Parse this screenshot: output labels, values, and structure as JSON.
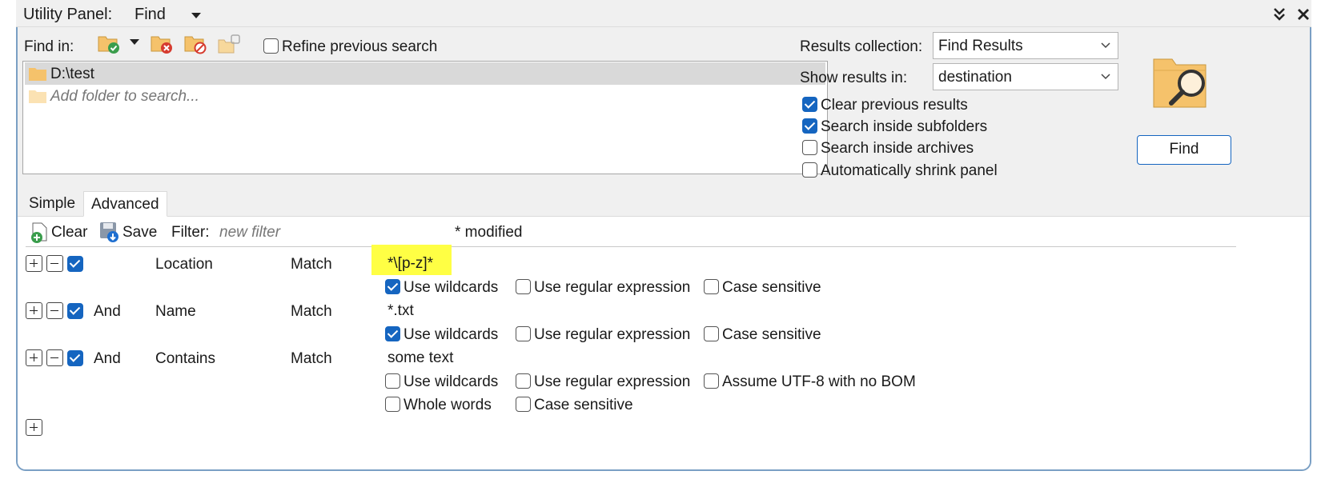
{
  "titlebar": {
    "label": "Utility Panel:",
    "value": "Find",
    "dropdown_icon": "caret-down-icon",
    "collapse_icon": "double-chevron-down-icon",
    "close_icon": "close-icon"
  },
  "findin": {
    "label": "Find in:",
    "refine_label": "Refine previous search",
    "refine_checked": false
  },
  "folders": {
    "items": [
      "D:\\test"
    ],
    "placeholder": "Add folder to search..."
  },
  "options": {
    "results_collection_label": "Results collection:",
    "results_collection_value": "Find Results",
    "show_results_label": "Show results in:",
    "show_results_value": "destination",
    "clear_previous": {
      "label": "Clear previous results",
      "checked": true
    },
    "search_subfolders": {
      "label": "Search inside subfolders",
      "checked": true
    },
    "search_archives": {
      "label": "Search inside archives",
      "checked": false
    },
    "auto_shrink": {
      "label": "Automatically shrink panel",
      "checked": false
    }
  },
  "find_button": "Find",
  "tabs": [
    "Simple",
    "Advanced"
  ],
  "toolbar": {
    "clear": "Clear",
    "save": "Save",
    "filter_label": "Filter:",
    "filter_placeholder": "new filter",
    "status": "* modified"
  },
  "rules": [
    {
      "enabled": true,
      "op": "",
      "field": "Location",
      "match": "Match",
      "value": "*\\[p-z]*",
      "highlighted": true,
      "opts": [
        {
          "label": "Use wildcards",
          "checked": true
        },
        {
          "label": "Use regular expression",
          "checked": false
        },
        {
          "label": "Case sensitive",
          "checked": false
        }
      ]
    },
    {
      "enabled": true,
      "op": "And",
      "field": "Name",
      "match": "Match",
      "value": "*.txt",
      "highlighted": false,
      "opts": [
        {
          "label": "Use wildcards",
          "checked": true
        },
        {
          "label": "Use regular expression",
          "checked": false
        },
        {
          "label": "Case sensitive",
          "checked": false
        }
      ]
    },
    {
      "enabled": true,
      "op": "And",
      "field": "Contains",
      "match": "Match",
      "value": "some text",
      "highlighted": false,
      "opts": [
        {
          "label": "Use wildcards",
          "checked": false
        },
        {
          "label": "Use regular expression",
          "checked": false
        },
        {
          "label": "Assume UTF-8 with no BOM",
          "checked": false
        },
        {
          "label": "Whole words",
          "checked": false
        },
        {
          "label": "Case sensitive",
          "checked": false
        }
      ]
    }
  ],
  "colors": {
    "accent": "#1565c0",
    "highlight": "#ffff44",
    "panel_border": "#7a9fc4",
    "folder": "#f5c26b"
  }
}
